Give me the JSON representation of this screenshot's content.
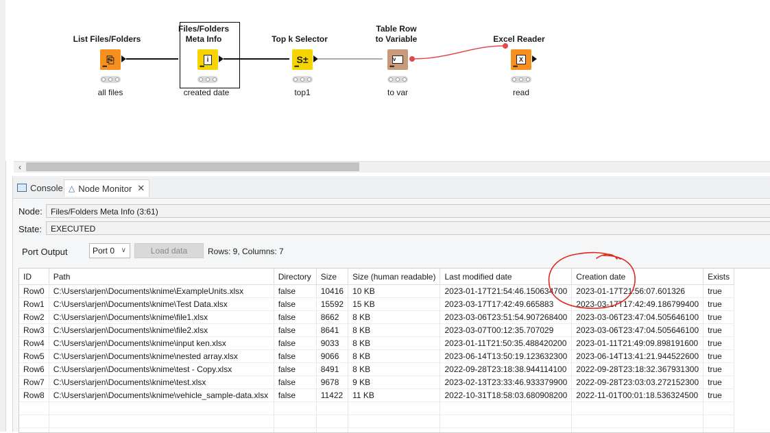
{
  "workflow": {
    "nodes": [
      {
        "title_lines": [
          "List Files/Folders"
        ],
        "label": "all files",
        "color": "#f7901e",
        "icon": "list-files-icon"
      },
      {
        "title_lines": [
          "Files/Folders",
          "Meta Info"
        ],
        "label": "created date",
        "color": "#f5d400",
        "icon": "info-icon"
      },
      {
        "title_lines": [
          "Top k Selector"
        ],
        "label": "top1",
        "color": "#f5d400",
        "icon": "top-k-icon",
        "glyph": "S±"
      },
      {
        "title_lines": [
          "Table Row",
          "to Variable"
        ],
        "label": "to var",
        "color": "#c99a7a",
        "icon": "row-to-variable-icon"
      },
      {
        "title_lines": [
          "Excel Reader"
        ],
        "label": "read",
        "color": "#f7901e",
        "icon": "excel-icon"
      }
    ]
  },
  "panel": {
    "tabs": [
      {
        "label": "Console",
        "icon": "console-icon"
      },
      {
        "label": "Node Monitor",
        "icon": "node-monitor-icon"
      }
    ],
    "node_label": "Node:",
    "node_value": "Files/Folders Meta Info  (3:61)",
    "state_label": "State:",
    "state_value": "EXECUTED",
    "port_output_label": "Port Output",
    "port_selected": "Port 0",
    "load_data_label": "Load data",
    "rows_cols": "Rows: 9, Columns: 7"
  },
  "table": {
    "columns": [
      "ID",
      "Path",
      "Directory",
      "Size",
      "Size (human readable)",
      "Last modified date",
      "Creation date",
      "Exists"
    ],
    "rows": [
      [
        "Row0",
        "C:\\Users\\arjen\\Documents\\knime\\ExampleUnits.xlsx",
        "false",
        "10416",
        "10 KB",
        "2023-01-17T21:54:46.150634700",
        "2023-01-17T21:56:07.601326",
        "true"
      ],
      [
        "Row1",
        "C:\\Users\\arjen\\Documents\\knime\\Test Data.xlsx",
        "false",
        "15592",
        "15 KB",
        "2023-03-17T17:42:49.665883",
        "2023-03-17T17:42:49.186799400",
        "true"
      ],
      [
        "Row2",
        "C:\\Users\\arjen\\Documents\\knime\\file1.xlsx",
        "false",
        "8662",
        "8 KB",
        "2023-03-06T23:51:54.907268400",
        "2023-03-06T23:47:04.505646100",
        "true"
      ],
      [
        "Row3",
        "C:\\Users\\arjen\\Documents\\knime\\file2.xlsx",
        "false",
        "8641",
        "8 KB",
        "2023-03-07T00:12:35.707029",
        "2023-03-06T23:47:04.505646100",
        "true"
      ],
      [
        "Row4",
        "C:\\Users\\arjen\\Documents\\knime\\input ken.xlsx",
        "false",
        "9033",
        "8 KB",
        "2023-01-11T21:50:35.488420200",
        "2023-01-11T21:49:09.898191600",
        "true"
      ],
      [
        "Row5",
        "C:\\Users\\arjen\\Documents\\knime\\nested array.xlsx",
        "false",
        "9066",
        "8 KB",
        "2023-06-14T13:50:19.123632300",
        "2023-06-14T13:41:21.944522600",
        "true"
      ],
      [
        "Row6",
        "C:\\Users\\arjen\\Documents\\knime\\test - Copy.xlsx",
        "false",
        "8491",
        "8 KB",
        "2022-09-28T23:18:38.944114100",
        "2022-09-28T23:18:32.367931300",
        "true"
      ],
      [
        "Row7",
        "C:\\Users\\arjen\\Documents\\knime\\test.xlsx",
        "false",
        "9678",
        "9 KB",
        "2023-02-13T23:33:46.933379900",
        "2022-09-28T23:03:03.272152300",
        "true"
      ],
      [
        "Row8",
        "C:\\Users\\arjen\\Documents\\knime\\vehicle_sample-data.xlsx",
        "false",
        "11422",
        "11 KB",
        "2022-10-31T18:58:03.680908200",
        "2022-11-01T00:01:18.536324500",
        "true"
      ]
    ]
  }
}
